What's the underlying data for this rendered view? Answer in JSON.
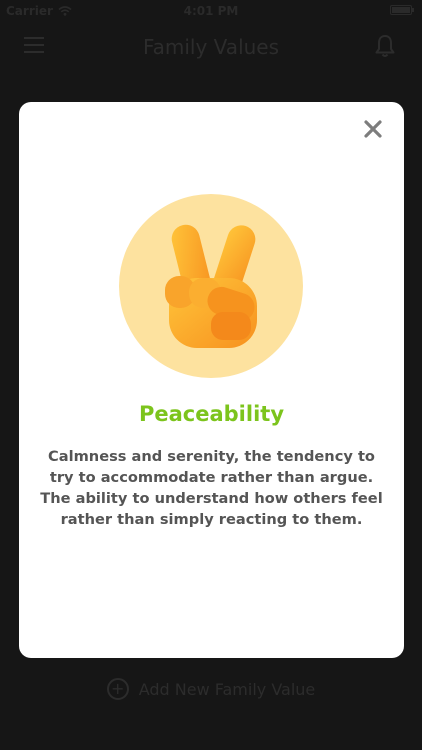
{
  "status_bar": {
    "carrier": "Carrier",
    "time": "4:01 PM"
  },
  "nav": {
    "title": "Family Values",
    "menu_icon": "hamburger-menu-icon",
    "notification_icon": "bell-icon"
  },
  "footer": {
    "add_label": "Add New Family Value",
    "add_icon": "plus-circle-icon"
  },
  "modal": {
    "close_icon": "close-icon",
    "emoji_icon": "victory-hand-icon",
    "title": "Peaceability",
    "description": "Calmness and serenity, the tendency to try to accommodate rather than argue. The ability to understand how others feel rather than simply reacting to them."
  },
  "colors": {
    "title_green": "#7cc41c",
    "emoji_circle": "#fde29f",
    "overlay_bg": "#161616"
  }
}
